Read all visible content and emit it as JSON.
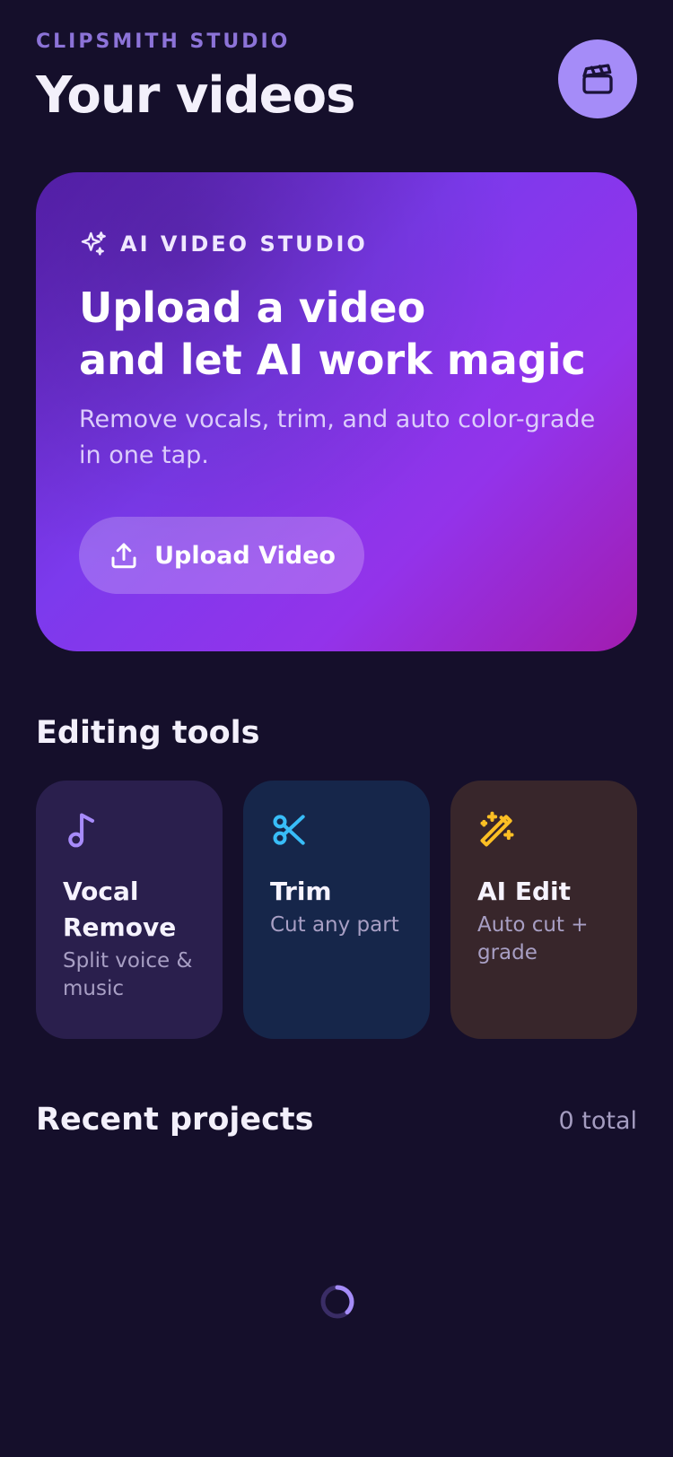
{
  "header": {
    "app_label": "CLIPSMITH STUDIO",
    "title": "Your videos",
    "action_icon": "clapperboard-icon"
  },
  "hero": {
    "eyebrow": "AI VIDEO STUDIO",
    "eyebrow_icon": "sparkles-icon",
    "heading_line1": "Upload a video",
    "heading_line2": "and let AI work magic",
    "subtitle": "Remove vocals, trim, and auto color-grade in one tap.",
    "button_label": "Upload Video",
    "button_icon": "upload-icon"
  },
  "tools": {
    "section_title": "Editing tools",
    "items": [
      {
        "title": "Vocal Remove",
        "subtitle": "Split voice & music",
        "icon": "music-note-icon",
        "color": "#a78bfa",
        "bg": "#2a1f4d"
      },
      {
        "title": "Trim",
        "subtitle": "Cut any part",
        "icon": "scissors-icon",
        "color": "#38bdf8",
        "bg": "#16264a"
      },
      {
        "title": "AI Edit",
        "subtitle": "Auto cut + grade",
        "icon": "magic-wand-icon",
        "color": "#fbbf24",
        "bg": "#38262b"
      }
    ]
  },
  "recent": {
    "section_title": "Recent projects",
    "total": "0 total"
  },
  "colors": {
    "background": "#150f2b",
    "accent": "#a58cf8",
    "hero_gradient_start": "#5b21b6",
    "hero_gradient_end": "#a21caf"
  }
}
